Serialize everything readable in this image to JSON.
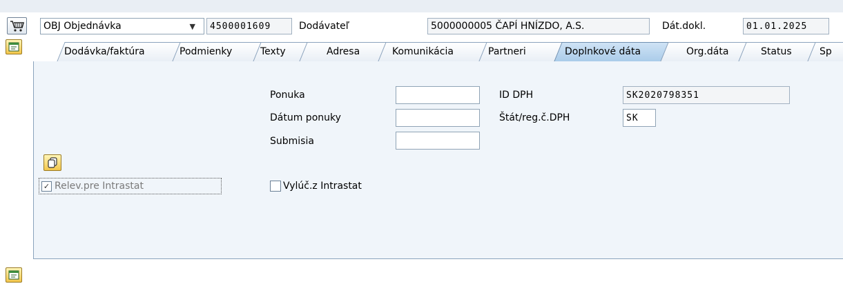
{
  "header": {
    "doc_type_value": "OBJ Objednávka",
    "doc_number": "4500001609",
    "vendor_label": "Dodávateľ",
    "vendor_value": "5000000005 ČAPÍ HNÍZDO, A.S.",
    "doc_date_label": "Dát.dokl.",
    "doc_date_value": "01.01.2025"
  },
  "tabs": [
    {
      "label": "Dodávka/faktúra"
    },
    {
      "label": "Podmienky"
    },
    {
      "label": "Texty"
    },
    {
      "label": "Adresa"
    },
    {
      "label": "Komunikácia"
    },
    {
      "label": "Partneri"
    },
    {
      "label": "Doplnkové dáta",
      "active": true
    },
    {
      "label": "Org.dáta"
    },
    {
      "label": "Status"
    },
    {
      "label": "Sp"
    }
  ],
  "form": {
    "offer_label": "Ponuka",
    "offer_value": "",
    "offer_date_label": "Dátum ponuky",
    "offer_date_value": "",
    "submission_label": "Submisia",
    "submission_value": "",
    "vat_id_label": "ID DPH",
    "vat_id_value": "SK2020798351",
    "vat_country_label": "Štát/reg.č.DPH",
    "vat_country_value": "SK",
    "intrastat_relevant_label": "Relev.pre Intrastat",
    "intrastat_relevant_checked": true,
    "intrastat_exclude_label": "Vylúč.z Intrastat",
    "intrastat_exclude_checked": false
  },
  "icons": {
    "cart": "shopping-cart-icon",
    "expand": "expand-header-icon",
    "copy": "copy-icon"
  }
}
